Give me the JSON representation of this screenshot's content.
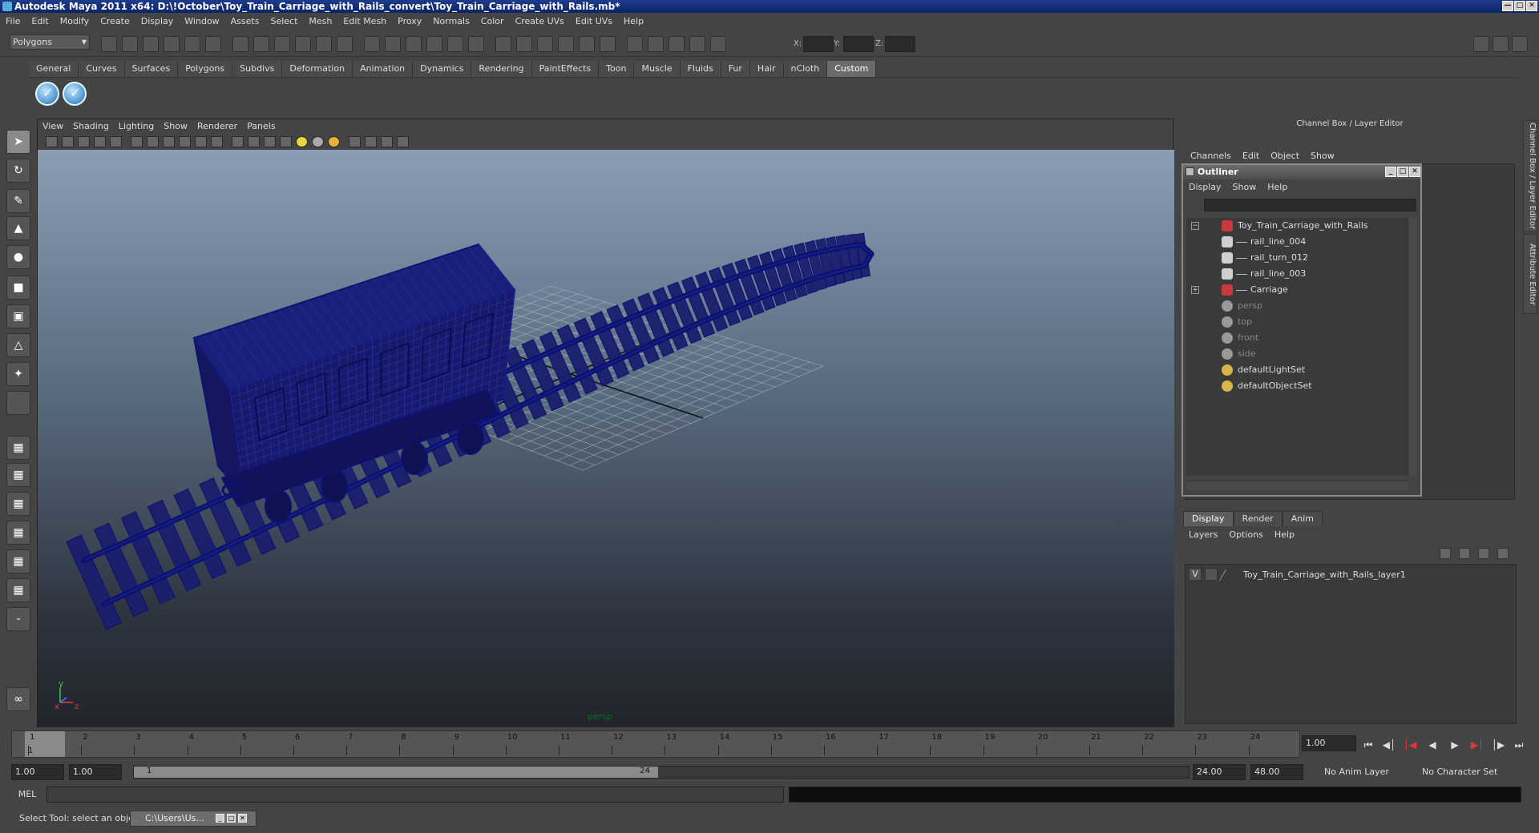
{
  "window": {
    "title": "Autodesk Maya 2011 x64: D:\\!October\\Toy_Train_Carriage_with_Rails_convert\\Toy_Train_Carriage_with_Rails.mb*"
  },
  "menubar": [
    "File",
    "Edit",
    "Modify",
    "Create",
    "Display",
    "Window",
    "Assets",
    "Select",
    "Mesh",
    "Edit Mesh",
    "Proxy",
    "Normals",
    "Color",
    "Create UVs",
    "Edit UVs",
    "Help"
  ],
  "statusline": {
    "mode": "Polygons",
    "x_label": "X:",
    "y_label": "Y:",
    "z_label": "Z:"
  },
  "shelf": {
    "tabs": [
      "General",
      "Curves",
      "Surfaces",
      "Polygons",
      "Subdivs",
      "Deformation",
      "Animation",
      "Dynamics",
      "Rendering",
      "PaintEffects",
      "Toon",
      "Muscle",
      "Fluids",
      "Fur",
      "Hair",
      "nCloth",
      "Custom"
    ],
    "active_tab": "Custom"
  },
  "viewport": {
    "menu": [
      "View",
      "Shading",
      "Lighting",
      "Show",
      "Renderer",
      "Panels"
    ],
    "camera_label": "persp",
    "axis_y": "y",
    "axis_x": "x",
    "axis_z": "z",
    "wire_color": "#0d1170"
  },
  "right_dock": {
    "title": "Channel Box / Layer Editor",
    "channel_menu": [
      "Channels",
      "Edit",
      "Object",
      "Show"
    ],
    "side_tabs": [
      "Channel Box / Layer Editor",
      "Attribute Editor"
    ]
  },
  "outliner": {
    "title": "Outliner",
    "menu": [
      "Display",
      "Show",
      "Help"
    ],
    "items": [
      {
        "label": "Toy_Train_Carriage_with_Rails",
        "indent": 0,
        "expander": "−",
        "icon": "group-icon",
        "dim": false
      },
      {
        "label": "rail_line_004",
        "indent": 1,
        "expander": "",
        "icon": "mesh-icon",
        "dim": false
      },
      {
        "label": "rail_turn_012",
        "indent": 1,
        "expander": "",
        "icon": "mesh-icon",
        "dim": false
      },
      {
        "label": "rail_line_003",
        "indent": 1,
        "expander": "",
        "icon": "mesh-icon",
        "dim": false
      },
      {
        "label": "Carriage",
        "indent": 1,
        "expander": "+",
        "icon": "group-icon",
        "dim": false
      },
      {
        "label": "persp",
        "indent": 0,
        "expander": "",
        "icon": "camera-icon",
        "dim": true
      },
      {
        "label": "top",
        "indent": 0,
        "expander": "",
        "icon": "camera-icon",
        "dim": true
      },
      {
        "label": "front",
        "indent": 0,
        "expander": "",
        "icon": "camera-icon",
        "dim": true
      },
      {
        "label": "side",
        "indent": 0,
        "expander": "",
        "icon": "camera-icon",
        "dim": true
      },
      {
        "label": "defaultLightSet",
        "indent": 0,
        "expander": "",
        "icon": "set-icon",
        "dim": false
      },
      {
        "label": "defaultObjectSet",
        "indent": 0,
        "expander": "",
        "icon": "set-icon",
        "dim": false
      }
    ]
  },
  "layer_editor": {
    "tabs": [
      "Display",
      "Render",
      "Anim"
    ],
    "active_tab": "Display",
    "menu": [
      "Layers",
      "Options",
      "Help"
    ],
    "layers": [
      {
        "visible": "V",
        "name": "Toy_Train_Carriage_with_Rails_layer1"
      }
    ]
  },
  "timeline": {
    "ticks": [
      "1",
      "2",
      "3",
      "4",
      "5",
      "6",
      "7",
      "8",
      "9",
      "10",
      "11",
      "12",
      "13",
      "14",
      "15",
      "16",
      "17",
      "18",
      "19",
      "20",
      "21",
      "22",
      "23",
      "24"
    ],
    "current_frame": "1.00",
    "current_marker": "1"
  },
  "range": {
    "start": "1.00",
    "playback_start": "1.00",
    "slider_start": "1",
    "slider_end": "24",
    "playback_end": "24.00",
    "end": "48.00",
    "anim_layer": "No Anim Layer",
    "character_set": "No Character Set"
  },
  "command": {
    "label": "MEL"
  },
  "help": {
    "text": "Select Tool: select an object",
    "task_label": "C:\\Users\\Us..."
  }
}
